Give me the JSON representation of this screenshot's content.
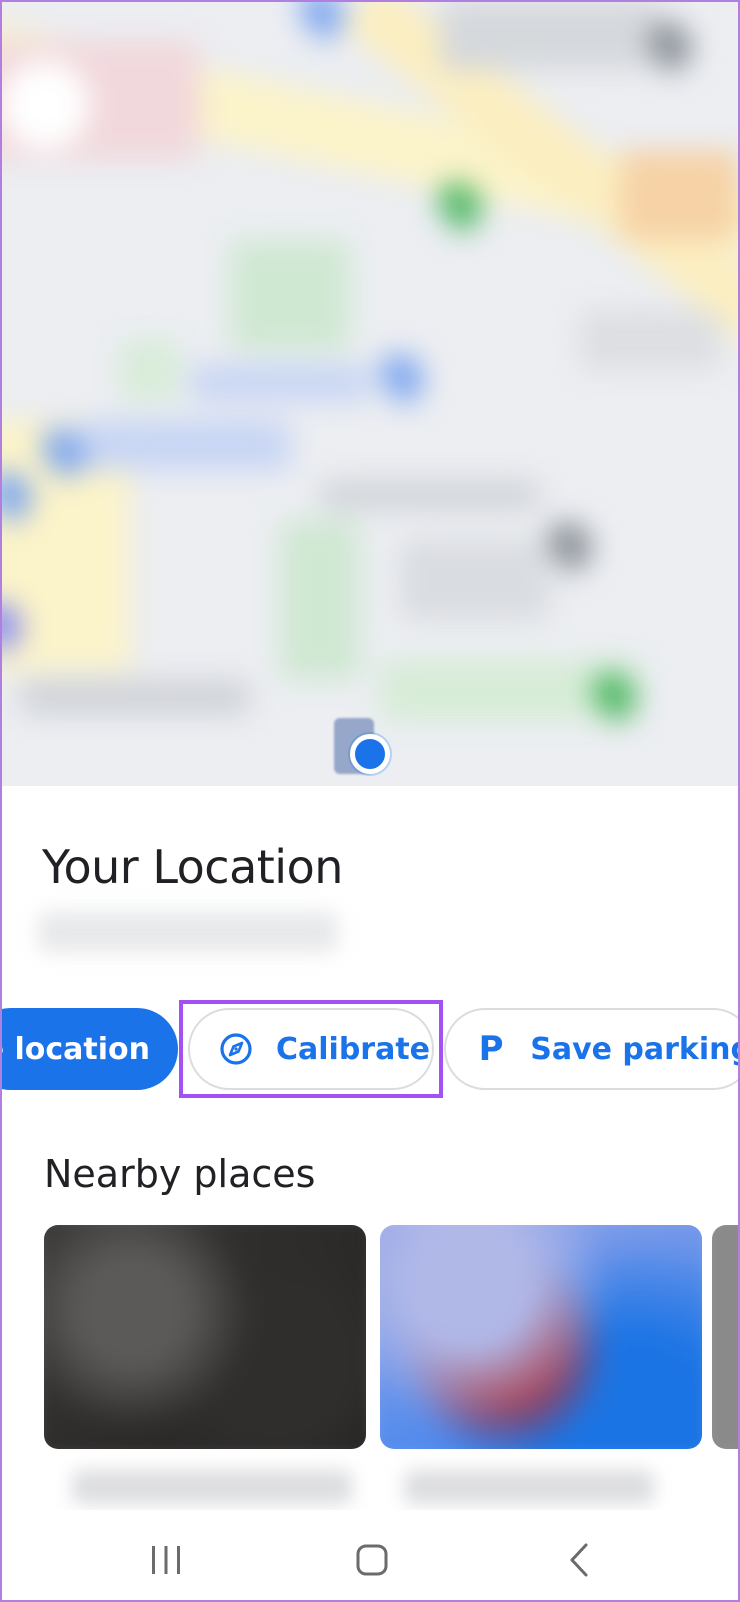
{
  "sheet": {
    "title": "Your Location"
  },
  "actions": {
    "share_label": "e location",
    "calibrate_label": "Calibrate",
    "parking_label": "Save parking"
  },
  "nearby": {
    "title": "Nearby places"
  },
  "colors": {
    "accent": "#1a73e8",
    "highlight": "#a550f0",
    "text": "#202124",
    "chip_border": "#dadce0"
  },
  "icons": {
    "calibrate": "compass-icon",
    "parking": "parking-p-icon",
    "nav_recents": "recents-icon",
    "nav_home": "home-icon",
    "nav_back": "back-icon"
  }
}
